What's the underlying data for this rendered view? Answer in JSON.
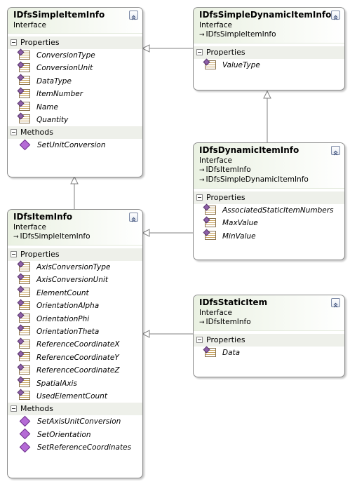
{
  "boxes": {
    "simple_item_info": {
      "title": "IDfsSimpleItemInfo",
      "kind": "Interface",
      "properties_label": "Properties",
      "properties": [
        "ConversionType",
        "ConversionUnit",
        "DataType",
        "ItemNumber",
        "Name",
        "Quantity"
      ],
      "methods_label": "Methods",
      "methods": [
        "SetUnitConversion"
      ]
    },
    "simple_dynamic_item_info": {
      "title": "IDfsSimpleDynamicItemInfo",
      "kind": "Interface",
      "inherits": [
        "IDfsSimpleItemInfo"
      ],
      "properties_label": "Properties",
      "properties": [
        "ValueType"
      ]
    },
    "dynamic_item_info": {
      "title": "IDfsDynamicItemInfo",
      "kind": "Interface",
      "inherits": [
        "IDfsItemInfo",
        "IDfsSimpleDynamicItemInfo"
      ],
      "properties_label": "Properties",
      "properties": [
        "AssociatedStaticItemNumbers",
        "MaxValue",
        "MinValue"
      ]
    },
    "item_info": {
      "title": "IDfsItemInfo",
      "kind": "Interface",
      "inherits": [
        "IDfsSimpleItemInfo"
      ],
      "properties_label": "Properties",
      "properties": [
        "AxisConversionType",
        "AxisConversionUnit",
        "ElementCount",
        "OrientationAlpha",
        "OrientationPhi",
        "OrientationTheta",
        "ReferenceCoordinateX",
        "ReferenceCoordinateY",
        "ReferenceCoordinateZ",
        "SpatialAxis",
        "UsedElementCount"
      ],
      "methods_label": "Methods",
      "methods": [
        "SetAxisUnitConversion",
        "SetOrientation",
        "SetReferenceCoordinates"
      ]
    },
    "static_item": {
      "title": "IDfsStaticItem",
      "kind": "Interface",
      "inherits": [
        "IDfsItemInfo"
      ],
      "properties_label": "Properties",
      "properties": [
        "Data"
      ]
    }
  },
  "colors": {
    "header_gradient_start": "#eaf1e2",
    "border": "#8c8c8c",
    "connector": "#808080",
    "section_bg": "#eef0ea",
    "method_icon": "#b56bd6"
  },
  "icons": {
    "property": "property-icon",
    "method": "method-icon",
    "inherits": "inherits-arrow-icon",
    "collapse": "collapse-chevron-icon"
  }
}
